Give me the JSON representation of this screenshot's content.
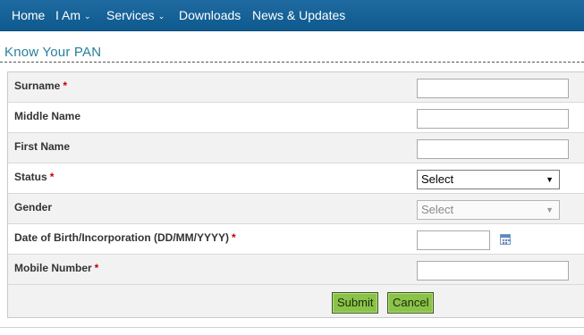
{
  "nav": {
    "items": [
      {
        "label": "Home",
        "caret": false
      },
      {
        "label": "I Am",
        "caret": true
      },
      {
        "label": "Services",
        "caret": true
      },
      {
        "label": "Downloads",
        "caret": false
      },
      {
        "label": "News & Updates",
        "caret": false
      }
    ],
    "caret_glyph": "⌄"
  },
  "page": {
    "title": "Know Your PAN"
  },
  "form": {
    "required_mark": "*",
    "fields": {
      "surname": {
        "label": "Surname",
        "required": true,
        "value": ""
      },
      "middle_name": {
        "label": "Middle Name",
        "required": false,
        "value": ""
      },
      "first_name": {
        "label": "First Name",
        "required": false,
        "value": ""
      },
      "status": {
        "label": "Status",
        "required": true,
        "selected": "Select"
      },
      "gender": {
        "label": "Gender",
        "required": false,
        "selected": "Select",
        "disabled": true
      },
      "dob": {
        "label": "Date of Birth/Incorporation (DD/MM/YYYY)",
        "required": true,
        "value": ""
      },
      "mobile": {
        "label": "Mobile Number",
        "required": true,
        "value": ""
      }
    },
    "buttons": {
      "submit": "Submit",
      "cancel": "Cancel"
    }
  },
  "colors": {
    "nav_bg": "#16649a",
    "title": "#287f9c",
    "required": "#c00000",
    "button_bg": "#8bc34a"
  }
}
